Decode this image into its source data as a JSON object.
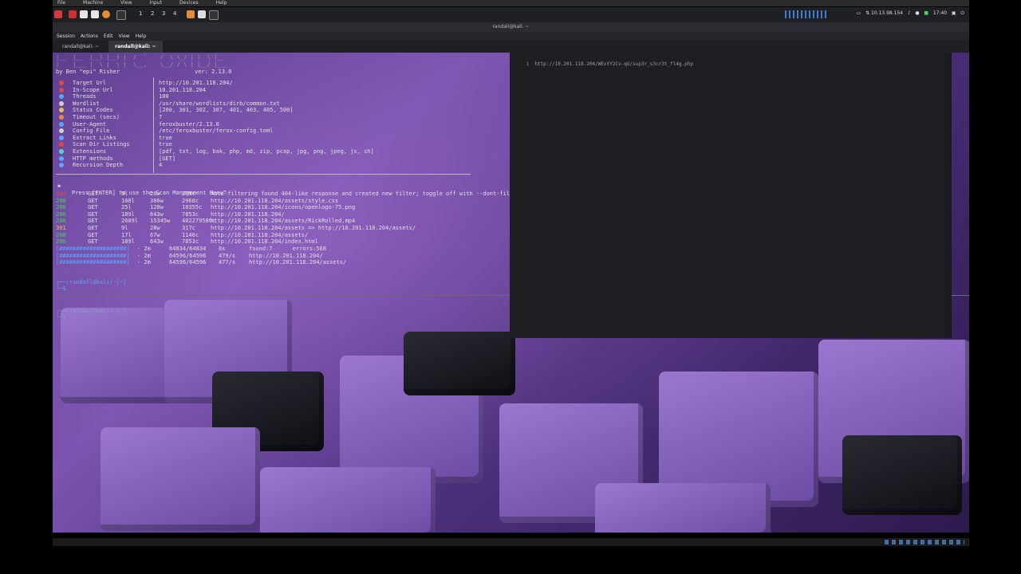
{
  "vm_menu": [
    "File",
    "Machine",
    "View",
    "Input",
    "Devices",
    "Help"
  ],
  "panel": {
    "workspaces": [
      "1",
      "2",
      "3",
      "4"
    ],
    "ip": "10.13.98.154",
    "clock": "17:40"
  },
  "window_title": "randall@kali: ~",
  "app_menu": [
    "Session",
    "Actions",
    "Edit",
    "View",
    "Help"
  ],
  "tabs": [
    {
      "label": "randall@kali: ~",
      "active": false
    },
    {
      "label": "randall@kali: ~",
      "active": true
    }
  ],
  "banner": {
    "art_line1": "|__  |__  |__) |__) |  /  `    /  \\ \\_/ | |  \\ |__",
    "art_line2": "|    |___ |  \\ |  \\ |  \\__,    \\__/ / \\ | |__/ |___",
    "credit": "by Ben \"epi\" Risher",
    "version": "ver: 2.13.0"
  },
  "config": [
    {
      "key": "Target Url",
      "value": "http://10.201.118.204/",
      "color": "#e04848"
    },
    {
      "key": "In-Scope Url",
      "value": "10.201.118.204",
      "color": "#e04848"
    },
    {
      "key": "Threads",
      "value": "100",
      "color": "#5aa6ff"
    },
    {
      "key": "Wordlist",
      "value": "/usr/share/wordlists/dirb/common.txt",
      "color": "#cfcfcf"
    },
    {
      "key": "Status Codes",
      "value": "[200, 301, 302, 307, 401, 403, 405, 500]",
      "color": "#e5c04f"
    },
    {
      "key": "Timeout (secs)",
      "value": "7",
      "color": "#e58b3a"
    },
    {
      "key": "User-Agent",
      "value": "feroxbuster/2.13.0",
      "color": "#5aa6ff"
    },
    {
      "key": "Config File",
      "value": "/etc/feroxbuster/ferox-config.toml",
      "color": "#cfcfcf"
    },
    {
      "key": "Extract Links",
      "value": "true",
      "color": "#5aa6ff"
    },
    {
      "key": "Scan Dir Listings",
      "value": "true",
      "color": "#e04848"
    },
    {
      "key": "Extensions",
      "value": "[pdf, txt, log, bak, php, md, zip, pcap, jpg, png, jpeg, js, sh]",
      "color": "#5fd0d0"
    },
    {
      "key": "HTTP methods",
      "value": "[GET]",
      "color": "#5aa6ff"
    },
    {
      "key": "Recursion Depth",
      "value": "4",
      "color": "#5aa6ff"
    }
  ],
  "press_enter_msg": "Press [ENTER] to use the Scan Management Menu™",
  "results": [
    {
      "status": "403",
      "method": "GET",
      "lines": "9l",
      "words": "28w",
      "chars": "279c",
      "url": "Auto-filtering found 404-like response and created new filter; toggle off with --dont-filter"
    },
    {
      "status": "200",
      "method": "GET",
      "lines": "108l",
      "words": "386w",
      "chars": "2968c",
      "url": "http://10.201.118.204/assets/style.css"
    },
    {
      "status": "200",
      "method": "GET",
      "lines": "25l",
      "words": "128w",
      "chars": "10355c",
      "url": "http://10.201.118.204/icons/openlogo-75.png"
    },
    {
      "status": "200",
      "method": "GET",
      "lines": "189l",
      "words": "643w",
      "chars": "7853c",
      "url": "http://10.201.118.204/"
    },
    {
      "status": "200",
      "method": "GET",
      "lines": "2609l",
      "words": "15345w",
      "chars": "402279586c",
      "url": "http://10.201.118.204/assets/RickRolled.mp4"
    },
    {
      "status": "301",
      "method": "GET",
      "lines": "9l",
      "words": "28w",
      "chars": "317c",
      "url": "http://10.201.118.204/assets => http://10.201.118.204/assets/"
    },
    {
      "status": "200",
      "method": "GET",
      "lines": "17l",
      "words": "67w",
      "chars": "1146c",
      "url": "http://10.201.118.204/assets/"
    },
    {
      "status": "200",
      "method": "GET",
      "lines": "189l",
      "words": "643w",
      "chars": "7853c",
      "url": "http://10.201.118.204/index.html"
    }
  ],
  "progress": [
    {
      "bar": "[####################]",
      "time": "- 2m",
      "count": "64834/64834",
      "rate": "0s",
      "extra": "found:7      errors:568"
    },
    {
      "bar": "[####################]",
      "time": "- 2m",
      "count": "64596/64596",
      "rate": "479/s",
      "extra": "http://10.201.118.204/"
    },
    {
      "bar": "[####################]",
      "time": "- 2m",
      "count": "64596/64596",
      "rate": "477/s",
      "extra": "http://10.201.118.204/assets/"
    }
  ],
  "prompt1": "┌──(randall@kali)-[~]",
  "prompt1b": "└─$ ",
  "prompt2": "┌──(randall@kali)-[~]",
  "prompt2b": "└─$ ",
  "right_pane": {
    "line_no": "1",
    "content": "http://10.201.118.204/WExYY2Cv-qU/sup3r_s3cr3t_fl4g.php"
  }
}
